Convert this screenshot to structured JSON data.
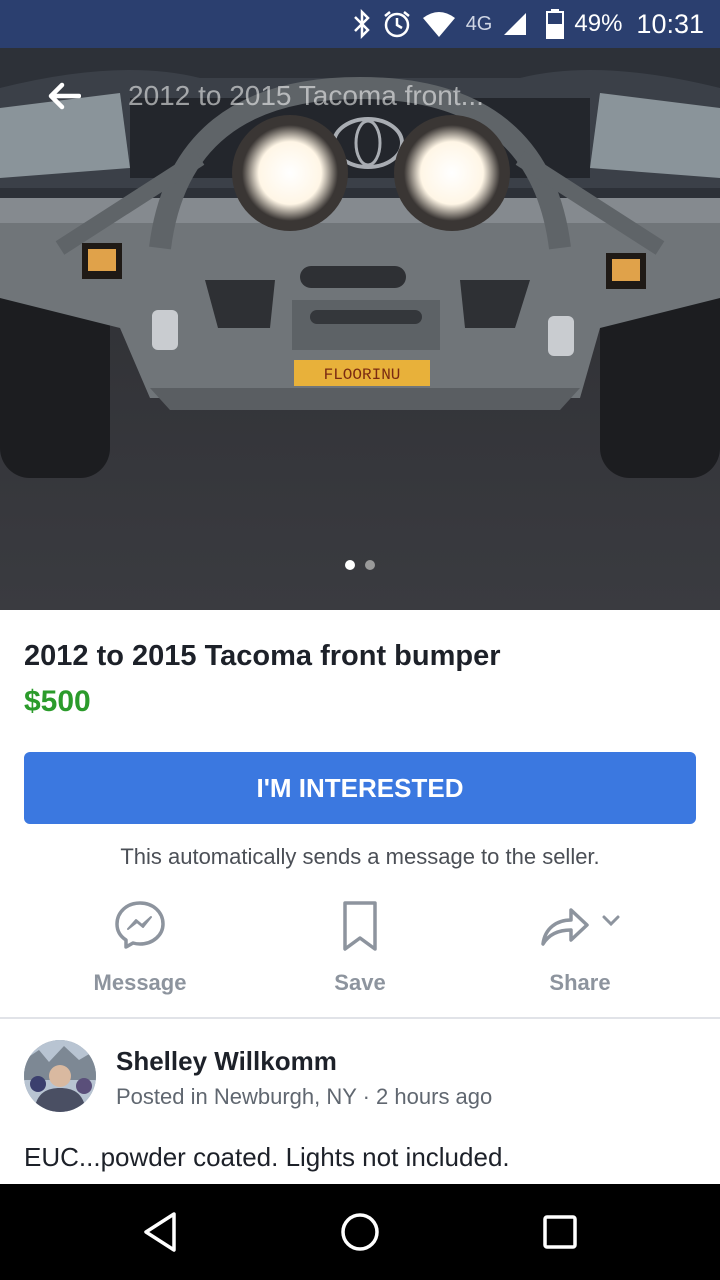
{
  "status_bar": {
    "icons": [
      "bluetooth-icon",
      "alarm-icon",
      "wifi-icon",
      "4g-lte-icon",
      "signal-icon",
      "battery-icon"
    ],
    "network": "4G",
    "battery": "49%",
    "time": "10:31"
  },
  "photo": {
    "title": "2012 to 2015 Tacoma front...",
    "plate_text": "FLOORINU",
    "pages": 2,
    "current_page": 1
  },
  "listing": {
    "title": "2012 to 2015 Tacoma front bumper",
    "price": "$500",
    "interest_button": "I'M INTERESTED",
    "auto_note": "This automatically sends a message to the seller."
  },
  "actions": {
    "message": "Message",
    "save": "Save",
    "share": "Share"
  },
  "seller": {
    "name": "Shelley Willkomm",
    "meta": "Posted in Newburgh, NY · 2 hours ago"
  },
  "description": "EUC...powder coated. Lights not included.",
  "colors": {
    "status_bar": "#2b3f6f",
    "price": "#2b9b2b",
    "primary_button": "#3b78e0",
    "muted_text": "#8d949e"
  }
}
